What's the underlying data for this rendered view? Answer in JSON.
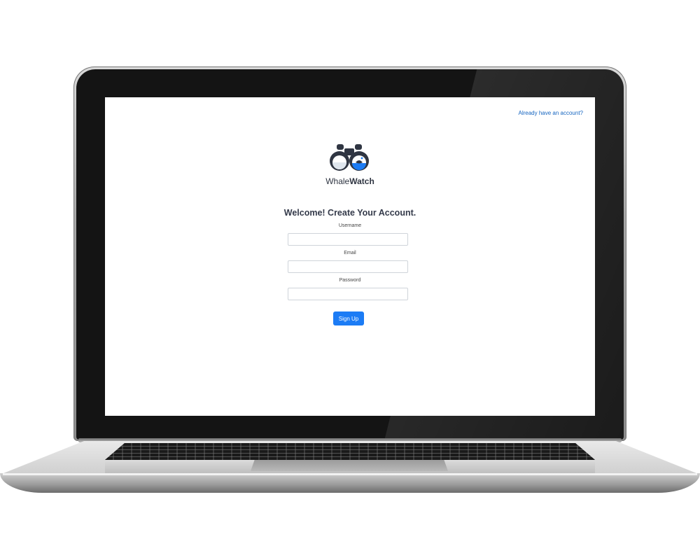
{
  "header": {
    "login_link": "Already have an account?"
  },
  "brand": {
    "logo_icon": "binoculars-icon",
    "name_part1": "Whale",
    "name_part2": "Watch"
  },
  "form": {
    "heading": "Welcome! Create Your Account.",
    "username_label": "Username",
    "username_value": "",
    "email_label": "Email",
    "email_value": "",
    "password_label": "Password",
    "password_value": "",
    "submit_label": "Sign Up"
  },
  "colors": {
    "accent": "#1c7cf5",
    "link": "#1565c0",
    "heading_text": "#343a4a",
    "logo_dark": "#2f3542"
  }
}
